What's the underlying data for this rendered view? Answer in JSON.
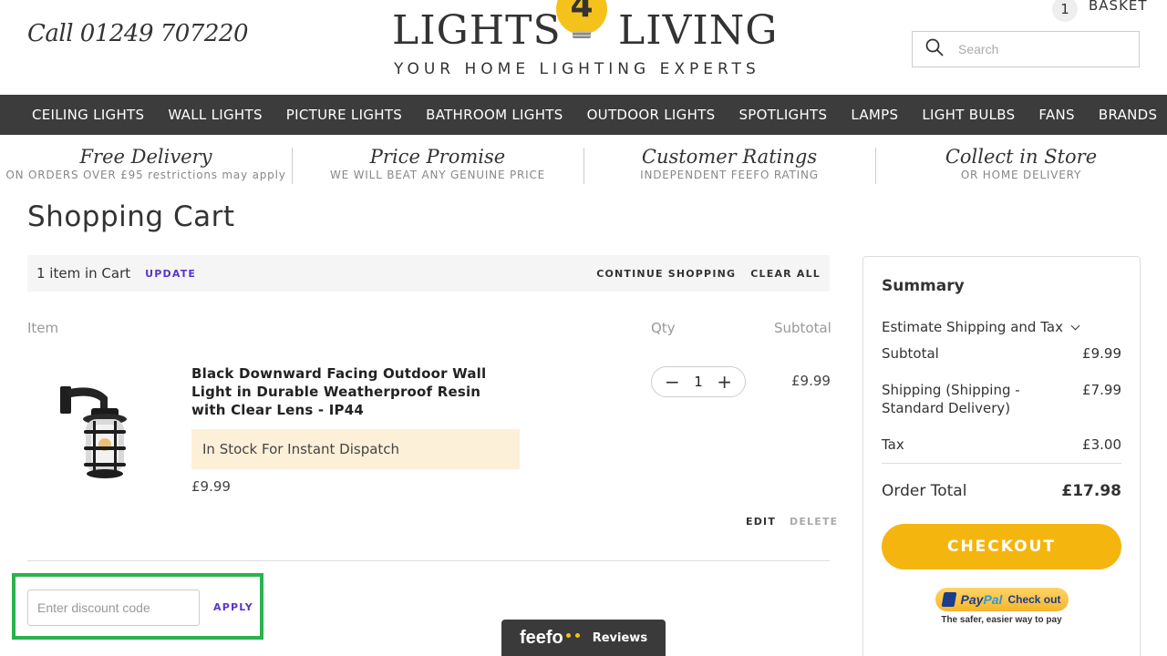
{
  "header": {
    "phone": "Call 01249 707220",
    "logo_left": "LIGHTS",
    "logo_number": "4",
    "logo_right": "LIVING",
    "tagline": "YOUR HOME LIGHTING EXPERTS",
    "basket_count": "1",
    "basket_label": "BASKET",
    "search_placeholder": "Search"
  },
  "nav": {
    "items": [
      {
        "label": "CEILING LIGHTS"
      },
      {
        "label": "WALL LIGHTS"
      },
      {
        "label": "PICTURE LIGHTS"
      },
      {
        "label": "BATHROOM LIGHTS"
      },
      {
        "label": "OUTDOOR LIGHTS"
      },
      {
        "label": "SPOTLIGHTS"
      },
      {
        "label": "LAMPS"
      },
      {
        "label": "LIGHT BULBS"
      },
      {
        "label": "FANS"
      },
      {
        "label": "BRANDS"
      }
    ]
  },
  "usps": [
    {
      "title": "Free Delivery",
      "sub": "ON ORDERS OVER £95 restrictions may apply"
    },
    {
      "title": "Price Promise",
      "sub": "WE WILL BEAT ANY GENUINE PRICE"
    },
    {
      "title": "Customer Ratings",
      "sub": "INDEPENDENT FEEFO RATING"
    },
    {
      "title": "Collect in Store",
      "sub": "OR HOME DELIVERY"
    }
  ],
  "cart": {
    "title": "Shopping Cart",
    "count_label": "1 item in Cart",
    "update_label": "UPDATE",
    "continue_label": "CONTINUE SHOPPING",
    "clear_label": "CLEAR ALL",
    "columns": {
      "item": "Item",
      "qty": "Qty",
      "subtotal": "Subtotal"
    },
    "item": {
      "name": "Black Downward Facing Outdoor Wall Light in Durable Weatherproof Resin with Clear Lens - IP44",
      "stock": "In Stock For Instant Dispatch",
      "price": "£9.99",
      "qty": "1",
      "qty_minus": "−",
      "qty_plus": "+",
      "subtotal": "£9.99",
      "edit_label": "EDIT",
      "delete_label": "DELETE"
    },
    "discount": {
      "placeholder": "Enter discount code",
      "apply_label": "APPLY"
    }
  },
  "summary": {
    "title": "Summary",
    "estimate_label": "Estimate Shipping and Tax",
    "subtotal_label": "Subtotal",
    "subtotal_value": "£9.99",
    "shipping_label": "Shipping (Shipping - Standard Delivery)",
    "shipping_value": "£7.99",
    "tax_label": "Tax",
    "tax_value": "£3.00",
    "total_label": "Order Total",
    "total_value": "£17.98",
    "checkout_label": "CHECKOUT",
    "paypal_pay": "Pay",
    "paypal_pal": "Pal",
    "paypal_checkout": "Check out",
    "paypal_tagline": "The safer, easier way to pay"
  },
  "feefo": {
    "logo": "feefo",
    "label": "Reviews"
  },
  "colors": {
    "accent": "#f5b50f",
    "link": "#5b35c9",
    "nav_bg": "#3c3c3c",
    "highlight_frame": "#2bb24c"
  }
}
